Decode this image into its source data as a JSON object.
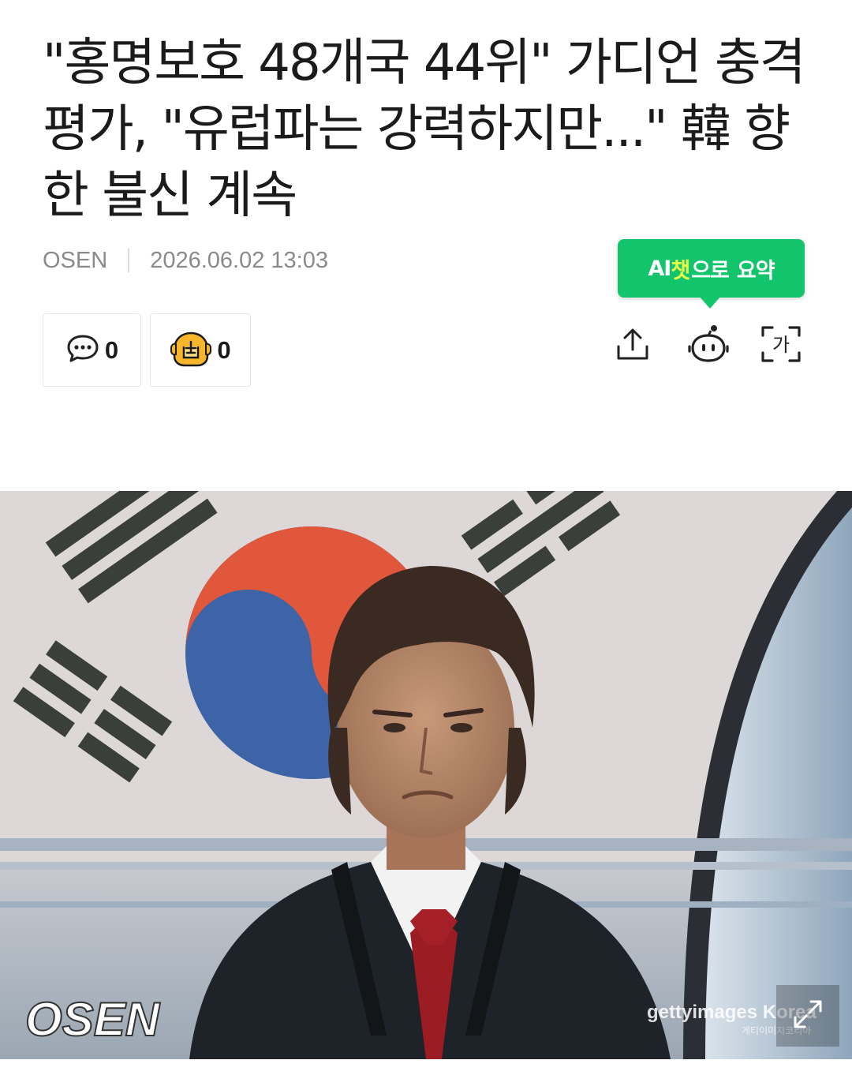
{
  "article": {
    "headline": "\"홍명보호 48개국 44위\" 가디언 충격 평가, \"유럽파는 강력하지만...\" 韓 향한 불신 계속",
    "source": "OSEN",
    "datetime": "2026.06.02 13:03"
  },
  "ai_summary": {
    "part1": "AI",
    "part2": "챗",
    "part3": "으로",
    "part4": "요약",
    "color": "#12c46b"
  },
  "reactions": {
    "comments_count": "0",
    "emotion_count": "0"
  },
  "toolbar": {
    "icons": [
      "share-icon",
      "ai-bot-icon",
      "font-size-icon"
    ],
    "font_icon_glyph": "가"
  },
  "photo": {
    "watermark_left": "OSEN",
    "watermark_right": "gettyimages Korea",
    "watermark_right_small": "게티이미지코리아",
    "icons": [
      "expand-icon"
    ]
  }
}
